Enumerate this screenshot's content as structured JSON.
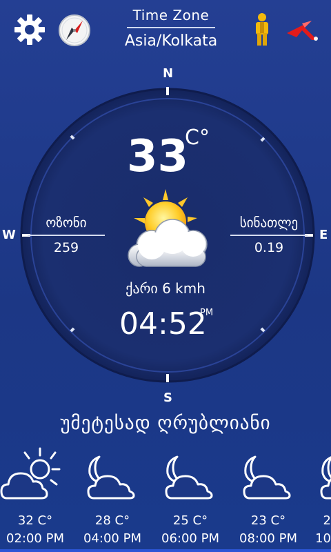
{
  "header": {
    "tz_label": "Time Zone",
    "tz_value": "Asia/Kolkata",
    "icons": [
      "gear-icon",
      "compass-icon",
      "person-icon",
      "red-arrow-icon"
    ]
  },
  "compass": {
    "n": "N",
    "s": "S",
    "w": "W",
    "e": "E"
  },
  "current": {
    "temp": "33",
    "unit": "C°",
    "left_label": "ოზონი",
    "left_value": "259",
    "right_label": "სინათლე",
    "right_value": "0.19",
    "wind": "ქარი 6 kmh",
    "time": "04:52",
    "ampm": "PM",
    "condition": "უმეტესად ღრუბლიანი"
  },
  "forecast": [
    {
      "temp": "32 C°",
      "hour": "02:00 PM",
      "icon": "partly-sunny-cloud-icon"
    },
    {
      "temp": "28 C°",
      "hour": "04:00 PM",
      "icon": "moon-cloud-icon"
    },
    {
      "temp": "25 C°",
      "hour": "06:00 PM",
      "icon": "moon-cloud-icon"
    },
    {
      "temp": "23 C°",
      "hour": "08:00 PM",
      "icon": "moon-cloud-icon"
    },
    {
      "temp": "2",
      "hour": "10",
      "icon": "moon-cloud-icon"
    }
  ],
  "colors": {
    "background": "#1f3a8a",
    "dial": "#1b2f6e",
    "accent_red": "#e21b1b",
    "person_yellow": "#f2b90c"
  }
}
